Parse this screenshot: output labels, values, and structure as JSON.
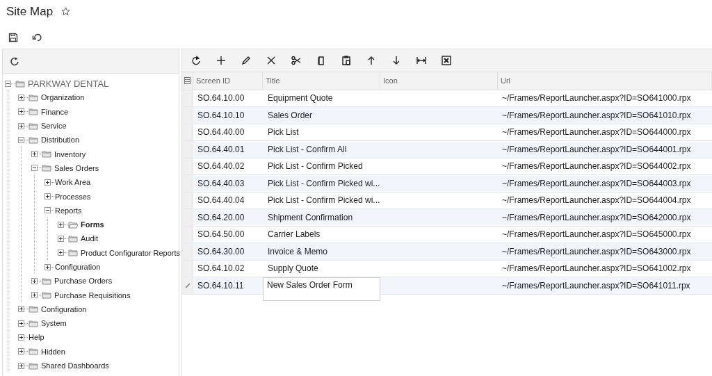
{
  "page": {
    "title": "Site Map",
    "favorite": false
  },
  "tree": [
    {
      "label": "PARKWAY DENTAL",
      "kind": "root",
      "expanded": true,
      "selected": false,
      "children": [
        {
          "label": "Organization",
          "kind": "folder",
          "expanded": false,
          "selected": false
        },
        {
          "label": "Finance",
          "kind": "folder",
          "expanded": false,
          "selected": false
        },
        {
          "label": "Service",
          "kind": "folder",
          "expanded": false,
          "selected": false
        },
        {
          "label": "Distribution",
          "kind": "folder",
          "expanded": true,
          "selected": false,
          "children": [
            {
              "label": "Inventory",
              "kind": "folder",
              "expanded": false,
              "selected": false
            },
            {
              "label": "Sales Orders",
              "kind": "folder",
              "expanded": true,
              "selected": false,
              "children": [
                {
                  "label": "Work Area",
                  "kind": "item",
                  "expanded": false,
                  "selected": false
                },
                {
                  "label": "Processes",
                  "kind": "item",
                  "expanded": false,
                  "selected": false
                },
                {
                  "label": "Reports",
                  "kind": "item",
                  "expanded": true,
                  "selected": false,
                  "children": [
                    {
                      "label": "Forms",
                      "kind": "folder",
                      "expanded": false,
                      "selected": true
                    },
                    {
                      "label": "Audit",
                      "kind": "folder",
                      "expanded": false,
                      "selected": false
                    },
                    {
                      "label": "Product Configurator Reports",
                      "kind": "folder",
                      "expanded": false,
                      "selected": false
                    }
                  ]
                },
                {
                  "label": "Configuration",
                  "kind": "item",
                  "expanded": false,
                  "selected": false
                }
              ]
            },
            {
              "label": "Purchase Orders",
              "kind": "folder",
              "expanded": false,
              "selected": false
            },
            {
              "label": "Purchase Requisitions",
              "kind": "folder",
              "expanded": false,
              "selected": false
            }
          ]
        },
        {
          "label": "Configuration",
          "kind": "folder",
          "expanded": false,
          "selected": false
        },
        {
          "label": "System",
          "kind": "folder",
          "expanded": false,
          "selected": false
        },
        {
          "label": "Help",
          "kind": "item",
          "expanded": false,
          "selected": false
        },
        {
          "label": "Hidden",
          "kind": "folder",
          "expanded": false,
          "selected": false
        },
        {
          "label": "Shared Dashboards",
          "kind": "folder",
          "expanded": false,
          "selected": false
        }
      ]
    }
  ],
  "table": {
    "columns": [
      "Screen ID",
      "Title",
      "Icon",
      "Url"
    ],
    "rows": [
      {
        "screen_id": "SO.64.10.00",
        "title": "Equipment Quote",
        "url": "~/Frames/ReportLauncher.aspx?ID=SO641000.rpx",
        "editing": false
      },
      {
        "screen_id": "SO.64.10.10",
        "title": "Sales Order",
        "url": "~/Frames/ReportLauncher.aspx?ID=SO641010.rpx",
        "editing": false
      },
      {
        "screen_id": "SO.64.40.00",
        "title": "Pick List",
        "url": "~/Frames/ReportLauncher.aspx?ID=SO644000.rpx",
        "editing": false
      },
      {
        "screen_id": "SO.64.40.01",
        "title": "Pick List - Confirm All",
        "url": "~/Frames/ReportLauncher.aspx?ID=SO644001.rpx",
        "editing": false
      },
      {
        "screen_id": "SO.64.40.02",
        "title": "Pick List - Confirm Picked",
        "url": "~/Frames/ReportLauncher.aspx?ID=SO644002.rpx",
        "editing": false
      },
      {
        "screen_id": "SO.64.40.03",
        "title": "Pick List - Confirm Picked wi...",
        "url": "~/Frames/ReportLauncher.aspx?ID=SO644003.rpx",
        "editing": false
      },
      {
        "screen_id": "SO.64.40.04",
        "title": "Pick List - Confirm Picked wi...",
        "url": "~/Frames/ReportLauncher.aspx?ID=SO644004.rpx",
        "editing": false
      },
      {
        "screen_id": "SO.64.20.00",
        "title": "Shipment Confirmation",
        "url": "~/Frames/ReportLauncher.aspx?ID=SO642000.rpx",
        "editing": false
      },
      {
        "screen_id": "SO.64.50.00",
        "title": "Carrier Labels",
        "url": "~/Frames/ReportLauncher.aspx?ID=SO645000.rpx",
        "editing": false
      },
      {
        "screen_id": "SO.64.30.00",
        "title": "Invoice & Memo",
        "url": "~/Frames/ReportLauncher.aspx?ID=SO643000.rpx",
        "editing": false
      },
      {
        "screen_id": "SO.64.10.02",
        "title": "Supply Quote",
        "url": "~/Frames/ReportLauncher.aspx?ID=SO641002.rpx",
        "editing": false
      },
      {
        "screen_id": "SO.64.10.11",
        "title": "New Sales Order Form",
        "url": "~/Frames/ReportLauncher.aspx?ID=SO641011.rpx",
        "editing": true
      }
    ]
  }
}
